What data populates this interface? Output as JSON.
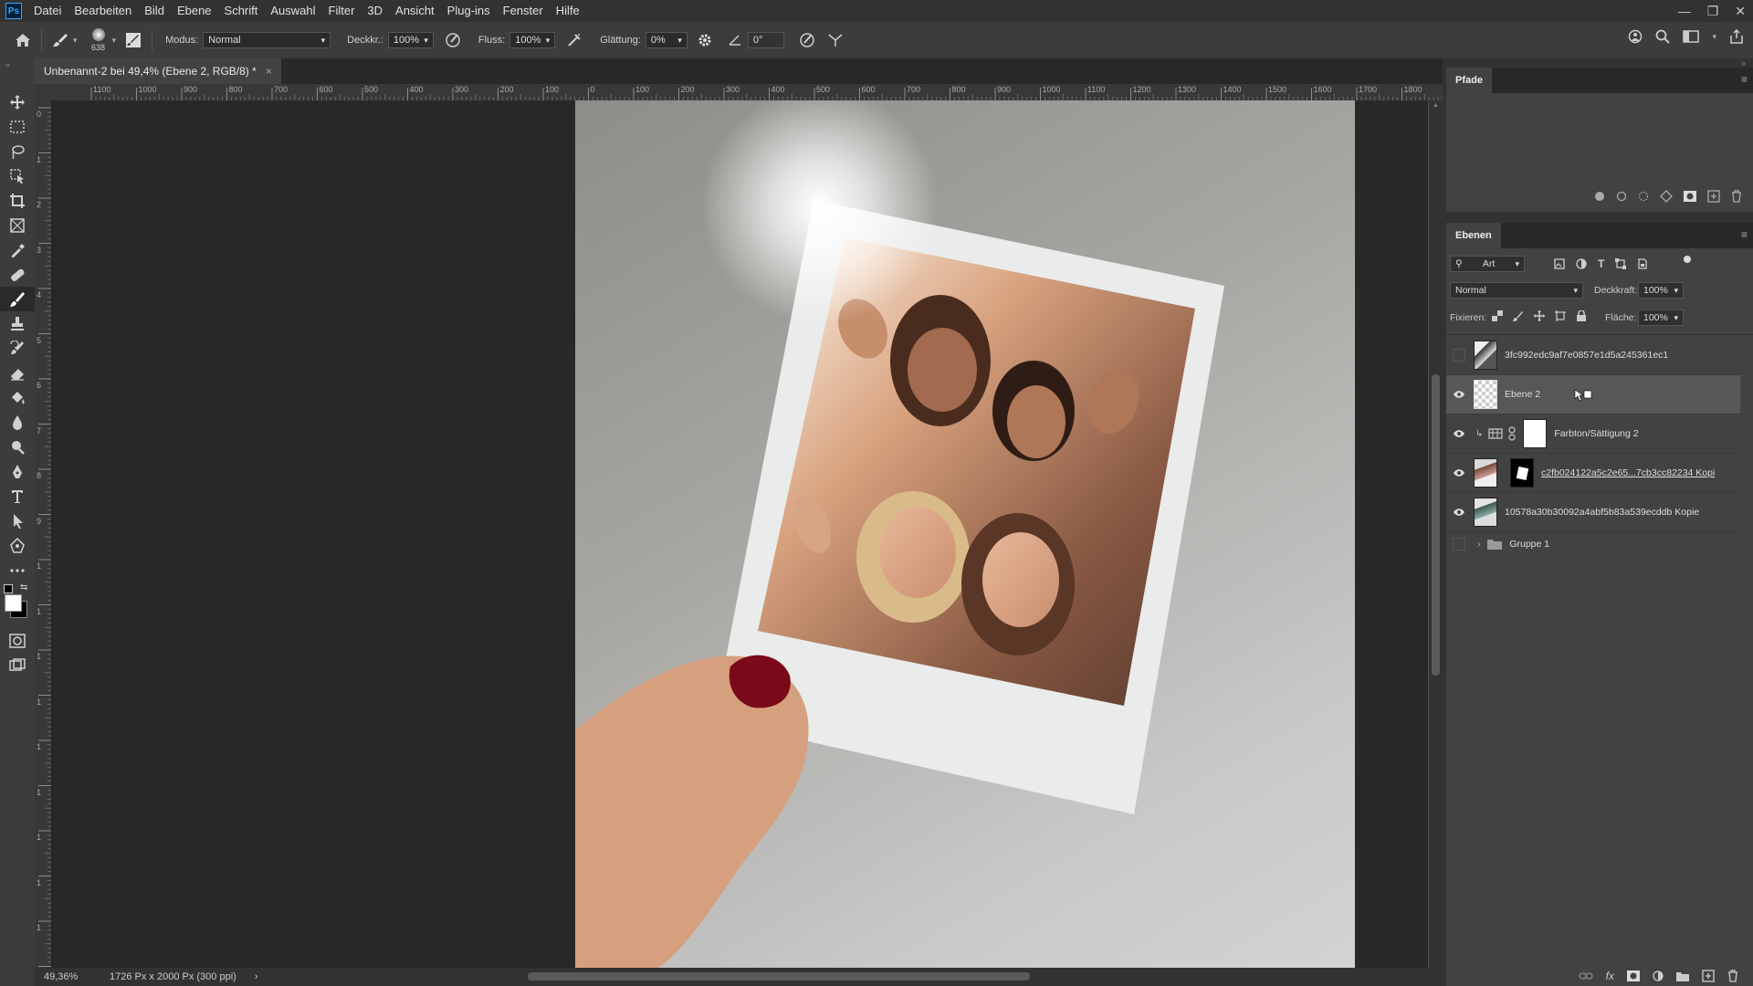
{
  "menu": {
    "logo": "Ps",
    "items": [
      "Datei",
      "Bearbeiten",
      "Bild",
      "Ebene",
      "Schrift",
      "Auswahl",
      "Filter",
      "3D",
      "Ansicht",
      "Plug-ins",
      "Fenster",
      "Hilfe"
    ]
  },
  "options": {
    "brush_size": "638",
    "mode_label": "Modus:",
    "mode_value": "Normal",
    "opacity_label": "Deckkr.:",
    "opacity_value": "100%",
    "flow_label": "Fluss:",
    "flow_value": "100%",
    "smoothing_label": "Glättung:",
    "smoothing_value": "0%",
    "angle_value": "0°"
  },
  "document": {
    "tab_title": "Unbenannt-2 bei 49,4% (Ebene 2, RGB/8) *",
    "close_glyph": "×"
  },
  "ruler": {
    "top_labels": [
      "1100",
      "1000",
      "900",
      "800",
      "700",
      "600",
      "500",
      "400",
      "300",
      "200",
      "100",
      "0",
      "100",
      "200",
      "300",
      "400",
      "500",
      "600",
      "700",
      "800",
      "900",
      "1000",
      "1100",
      "1200",
      "1300",
      "1400",
      "1500",
      "1600",
      "1700",
      "1800"
    ],
    "left_labels": [
      "0",
      "1",
      "2",
      "3",
      "4",
      "5",
      "6",
      "7",
      "8",
      "9",
      "1",
      "1",
      "1",
      "1",
      "1",
      "1",
      "1",
      "1",
      "1",
      "1"
    ]
  },
  "status": {
    "zoom": "49,36%",
    "doc_info": "1726 Px x 2000 Px (300 ppi)",
    "arrow": "›"
  },
  "panels": {
    "paths_tab": "Pfade",
    "layers_tab": "Ebenen",
    "filter_kind": "Art",
    "blend_mode": "Normal",
    "opacity_label": "Deckkraft:",
    "opacity_value": "100%",
    "lock_label": "Fixieren:",
    "fill_label": "Fläche:",
    "fill_value": "100%"
  },
  "layers": [
    {
      "name": "3fc992edc9af7e0857e1d5a245361ec1",
      "visible": false
    },
    {
      "name": "Ebene 2",
      "visible": true,
      "selected": true
    },
    {
      "name": "Farbton/Sättigung 2",
      "visible": true
    },
    {
      "name": "c2fb024122a5c2e65...7cb3cc82234 Kopie",
      "visible": true
    },
    {
      "name": "10578a30b30092a4abf5b83a539ecddb Kopie",
      "visible": true
    },
    {
      "name": "Gruppe 1",
      "visible": false
    }
  ],
  "colors": {
    "menubar": "#323232",
    "panel": "#424242",
    "canvas": "#282828",
    "accent": "#31a8ff"
  }
}
